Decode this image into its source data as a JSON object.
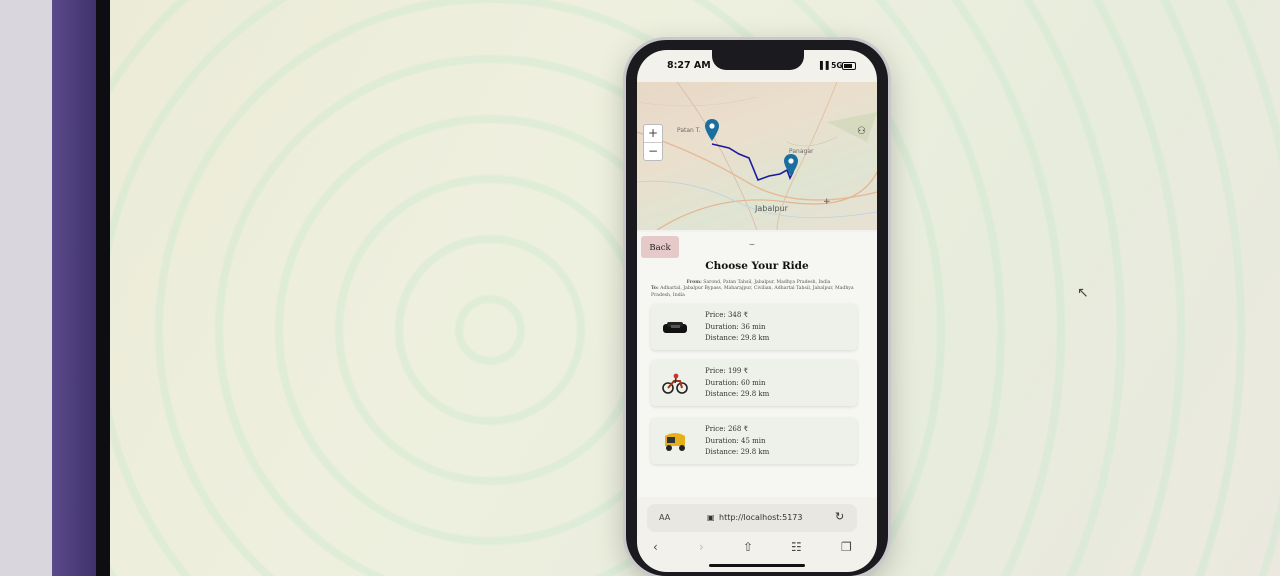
{
  "status_bar": {
    "time": "8:27 AM",
    "signal": "5G"
  },
  "map": {
    "zoom_in": "+",
    "zoom_out": "−",
    "labels": {
      "panagar": "Panagar",
      "jabalpur": "Jabalpur",
      "patan": "Patan T."
    }
  },
  "header": {
    "back_label": "Back",
    "collapse_icon": "chevron-down-icon",
    "title": "Choose Your Ride"
  },
  "route": {
    "from_label": "From:",
    "from_value": "Sarond, Patan Tahsil, Jabalpur, Madhya Pradesh, India",
    "to_label": "To:",
    "to_value": "Adhartal, Jabalpur Bypass, Maharajpur, Civilian, Adhartal Tahsil, Jabalpur, Madhya Pradesh, India"
  },
  "rides": [
    {
      "icon": "car-icon",
      "price": "Price: 348 ₹",
      "duration": "Duration: 36 min",
      "distance": "Distance: 29.8 km"
    },
    {
      "icon": "motorbike-icon",
      "price": "Price: 199 ₹",
      "duration": "Duration: 60 min",
      "distance": "Distance: 29.8 km"
    },
    {
      "icon": "auto-rickshaw-icon",
      "price": "Price: 268 ₹",
      "duration": "Duration: 45 min",
      "distance": "Distance: 29.8 km"
    }
  ],
  "browser": {
    "text_size": "AA",
    "url": "http://localhost:5173"
  },
  "colors": {
    "route_line": "#1a1aa0",
    "marker": "#1a6fa0",
    "back_button": "#e6c9c9"
  }
}
